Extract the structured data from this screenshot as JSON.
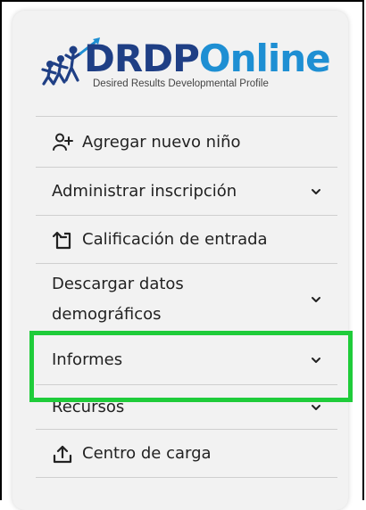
{
  "brand": {
    "name_part1": "DRDP",
    "name_part2": "Online",
    "tagline": "Desired Results Developmental Profile"
  },
  "nav": {
    "items": [
      {
        "label": "Agregar nuevo niño",
        "icon": "add-user-icon",
        "has_chevron": false
      },
      {
        "label": "Administrar inscripción",
        "icon": null,
        "has_chevron": true
      },
      {
        "label": "Calificación de entrada",
        "icon": "rating-entry-icon",
        "has_chevron": false
      },
      {
        "label": "Descargar datos demográficos",
        "line1": "Descargar datos",
        "line2": "demográficos",
        "icon": null,
        "has_chevron": true
      },
      {
        "label": "Informes",
        "icon": null,
        "has_chevron": true,
        "highlighted": true
      },
      {
        "label": "Recursos",
        "icon": null,
        "has_chevron": true
      },
      {
        "label": "Centro de carga",
        "icon": "upload-icon",
        "has_chevron": false
      }
    ]
  },
  "colors": {
    "highlight": "#1fcc3a",
    "brand_dark": "#1f3f85",
    "brand_light": "#1e8fd3"
  }
}
